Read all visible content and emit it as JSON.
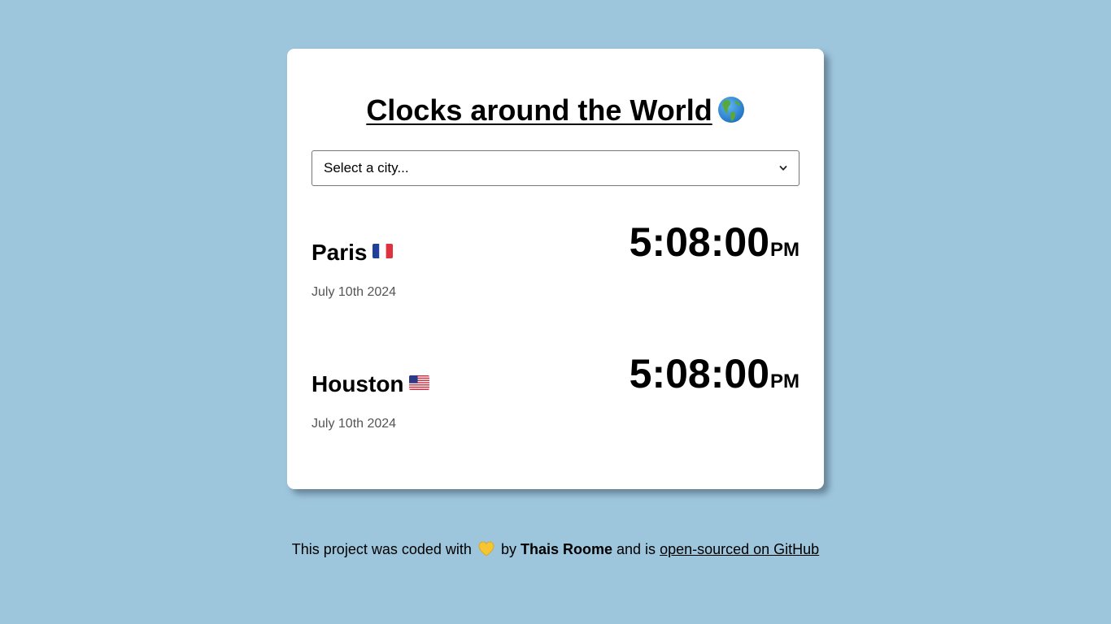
{
  "header": {
    "title": "Clocks around the World",
    "title_icon": "globe-americas-icon"
  },
  "city_select": {
    "selected": "Select a city...",
    "icon": "chevron-down-icon"
  },
  "cities": [
    {
      "name": "Paris",
      "flag": "flag-france-icon",
      "date": "July 10th 2024",
      "time": "5:08:00",
      "ampm": "PM"
    },
    {
      "name": "Houston",
      "flag": "flag-usa-icon",
      "date": "July 10th 2024",
      "time": "5:08:00",
      "ampm": "PM"
    }
  ],
  "footer": {
    "text_before": "This project was coded with",
    "heart_icon": "yellow-heart-icon",
    "by": "by",
    "author": "Thais Roome",
    "and_is": "and is",
    "link_text": "open-sourced on GitHub"
  },
  "colors": {
    "background": "#9dc5dc",
    "card": "#ffffff",
    "date_text": "#555555"
  }
}
